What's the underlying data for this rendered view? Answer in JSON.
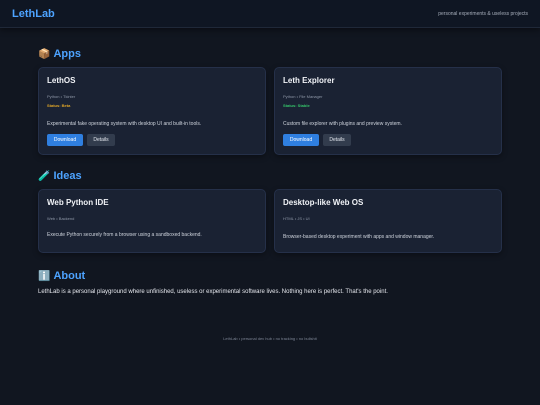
{
  "header": {
    "logo": "LethLab",
    "tagline": "personal experiments & useless projects"
  },
  "apps": {
    "icon": "📦",
    "title": "Apps",
    "cards": [
      {
        "name": "LethOS",
        "meta": "Python • Tkinter",
        "status": "Status: Beta",
        "status_color": "#e0a628",
        "description": "Experimental fake operating system with desktop UI and built-in tools.",
        "download_label": "Download",
        "details_label": "Details"
      },
      {
        "name": "Leth Explorer",
        "meta": "Python • File Manager",
        "status": "Status: Stable",
        "status_color": "#35c46a",
        "description": "Custom file explorer with plugins and preview system.",
        "download_label": "Download",
        "details_label": "Details"
      }
    ]
  },
  "ideas": {
    "icon": "🧪",
    "title": "Ideas",
    "cards": [
      {
        "name": "Web Python IDE",
        "meta": "Web • Backend",
        "description": "Execute Python securely from a browser using a sandboxed backend."
      },
      {
        "name": "Desktop-like Web OS",
        "meta": "HTML • JS • UI",
        "description": "Browser-based desktop experiment with apps and window manager."
      }
    ]
  },
  "about": {
    "icon": "ℹ️",
    "title": "About",
    "text": "LethLab is a personal playground where unfinished, useless or experimental software lives. Nothing here is perfect. That's the point."
  },
  "footer": {
    "text": "LethLab • personal dev hub • no tracking • no bullshit"
  },
  "colors": {
    "accent": "#4da3ff",
    "primary_button": "#2f7fe0",
    "background": "#111620",
    "card": "#1a2233"
  }
}
